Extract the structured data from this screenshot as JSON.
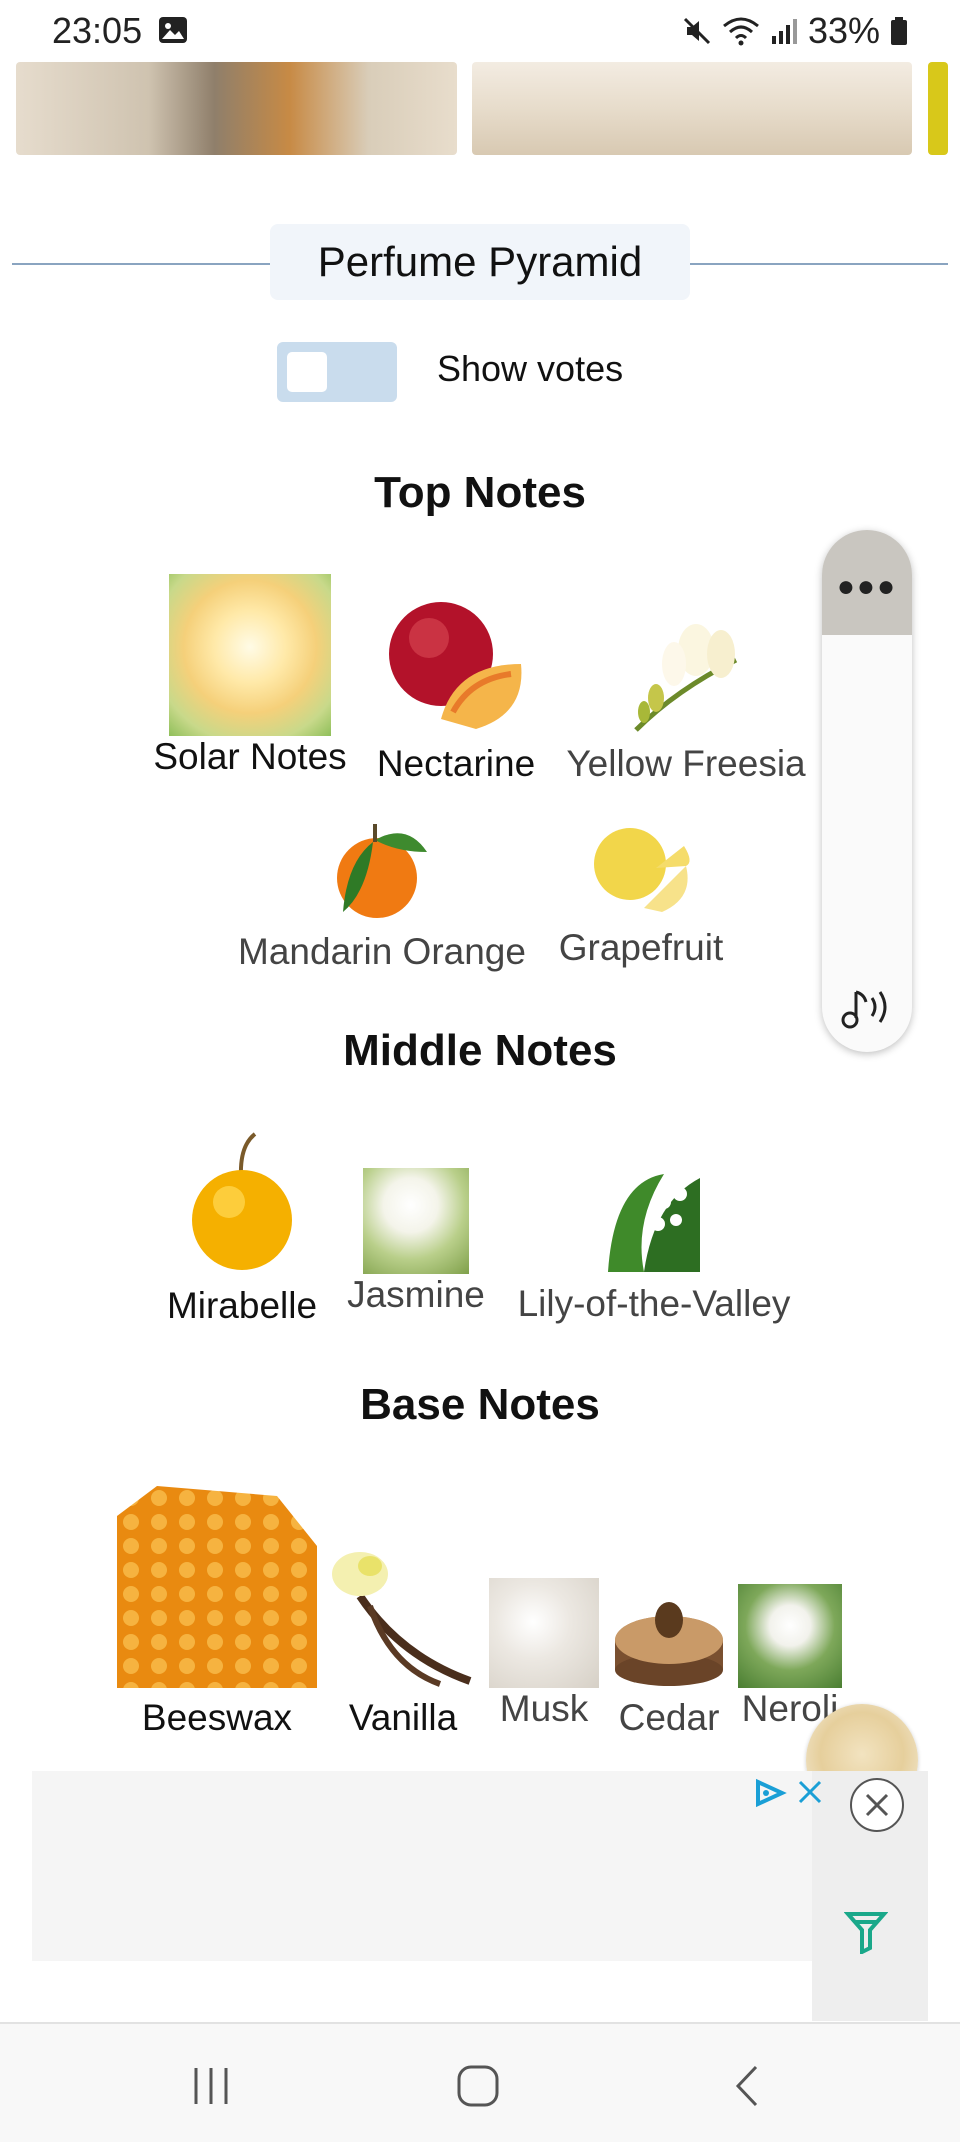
{
  "status_bar": {
    "time": "23:05",
    "battery": "33%"
  },
  "header": {
    "title": "Perfume Pyramid",
    "toggle_label": "Show votes"
  },
  "sections": {
    "top": {
      "title": "Top Notes",
      "notes": [
        "Solar Notes",
        "Nectarine",
        "Yellow Freesia",
        "Mandarin Orange",
        "Grapefruit"
      ]
    },
    "middle": {
      "title": "Middle Notes",
      "notes": [
        "Mirabelle",
        "Jasmine",
        "Lily-of-the-Valley"
      ]
    },
    "base": {
      "title": "Base Notes",
      "notes": [
        "Beeswax",
        "Vanilla",
        "Musk",
        "Cedar",
        "Neroli"
      ]
    }
  },
  "colors": {
    "rule": "#8aa4c0",
    "toggle_track": "#c9dced",
    "ad_accent": "#1a9fd6"
  }
}
